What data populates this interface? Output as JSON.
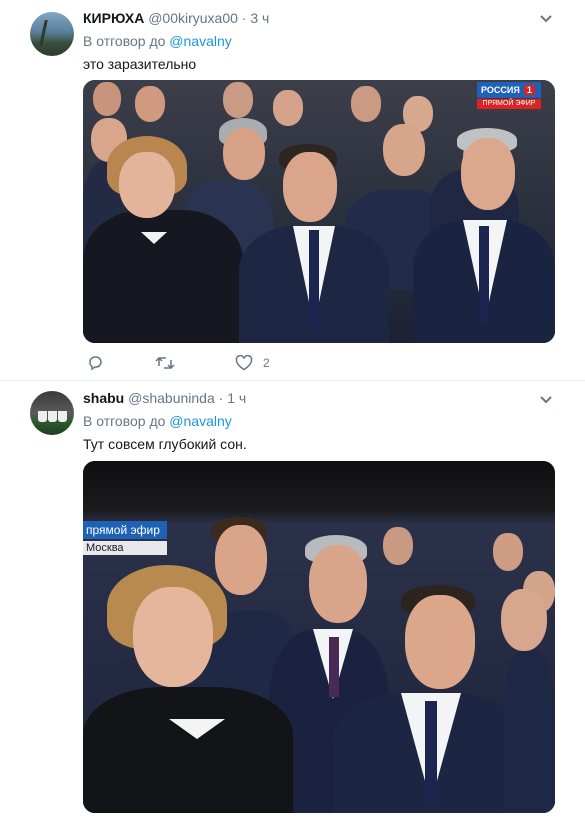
{
  "tweets": [
    {
      "name": "КИРЮХА",
      "handle": "@00kiryuxa00",
      "separator": "·",
      "time": "3 ч",
      "reply_prefix": "В отговор до",
      "reply_mention": "@navalny",
      "text": "это заразительно",
      "broadcast_logo": {
        "channel": "РОССИЯ",
        "number": "1",
        "live": "ПРЯМОЙ ЭФИР"
      },
      "actions": {
        "reply_count": "",
        "retweet_count": "",
        "like_count": "2"
      }
    },
    {
      "name": "shabu",
      "handle": "@shabuninda",
      "separator": "·",
      "time": "1 ч",
      "reply_prefix": "В отговор до",
      "reply_mention": "@navalny",
      "text": "Тут совсем глубокий сон.",
      "broadcast_banner": {
        "live": "прямой эфир",
        "city": "Москва"
      }
    }
  ],
  "colors": {
    "link": "#1b95e0",
    "secondary_text": "#657786",
    "divider": "#e6ecf0"
  },
  "icons": [
    "caret-down-icon",
    "reply-icon",
    "retweet-icon",
    "like-icon"
  ]
}
